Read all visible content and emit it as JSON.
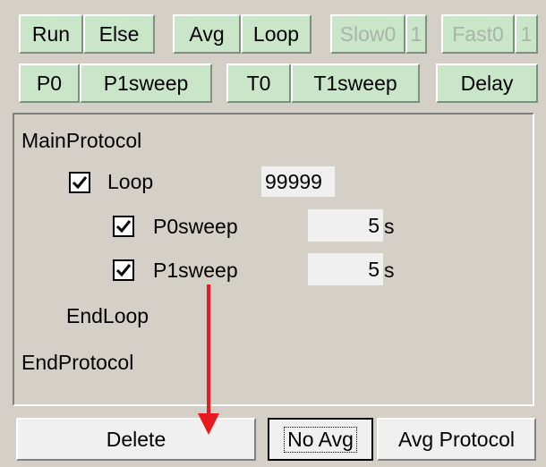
{
  "toolbar_row1": {
    "run": "Run",
    "else": "Else",
    "avg": "Avg",
    "loop": "Loop",
    "slow": "Slow0",
    "slow_count": "1",
    "fast": "Fast0",
    "fast_count": "1"
  },
  "toolbar_row2": {
    "p0": "P0",
    "p1sweep": "P1sweep",
    "t0": "T0",
    "t1sweep": "T1sweep",
    "delay": "Delay"
  },
  "protocol": {
    "main": "MainProtocol",
    "loop_label": "Loop",
    "loop_checked": true,
    "loop_count": "99999",
    "items": [
      {
        "label": "P0sweep",
        "checked": true,
        "value": "5",
        "unit": "s"
      },
      {
        "label": "P1sweep",
        "checked": true,
        "value": "5",
        "unit": "s"
      }
    ],
    "end_loop": "EndLoop",
    "end_protocol": "EndProtocol"
  },
  "bottom": {
    "delete": "Delete",
    "no_avg": "No Avg",
    "avg_protocol": "Avg Protocol"
  },
  "annotation": {
    "arrow_color": "#e8191f",
    "arrow_icon": "arrow-down-icon"
  }
}
